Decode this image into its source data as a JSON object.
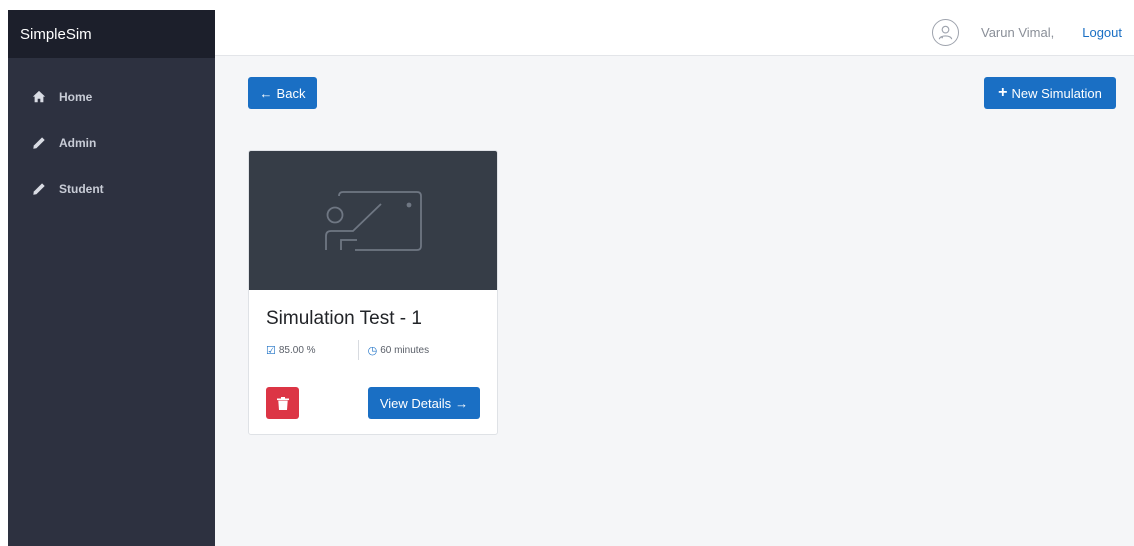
{
  "brand": "SimpleSim",
  "sidebar": {
    "items": [
      {
        "label": "Home",
        "icon": "home-icon"
      },
      {
        "label": "Admin",
        "icon": "pencil-icon"
      },
      {
        "label": "Student",
        "icon": "pencil-icon"
      }
    ]
  },
  "topbar": {
    "username": "Varun Vimal,",
    "logout_label": "Logout"
  },
  "toolbar": {
    "back_label": "Back",
    "new_label": "New Simulation"
  },
  "card": {
    "title": "Simulation Test - 1",
    "score": "85.00 %",
    "duration": "60 minutes",
    "view_label": "View Details"
  },
  "colors": {
    "sidebar_bg": "#2d3140",
    "brand_bg": "#1c1f2b",
    "primary": "#1a6fc4",
    "danger": "#dc3545",
    "thumb_bg": "#363d47"
  }
}
